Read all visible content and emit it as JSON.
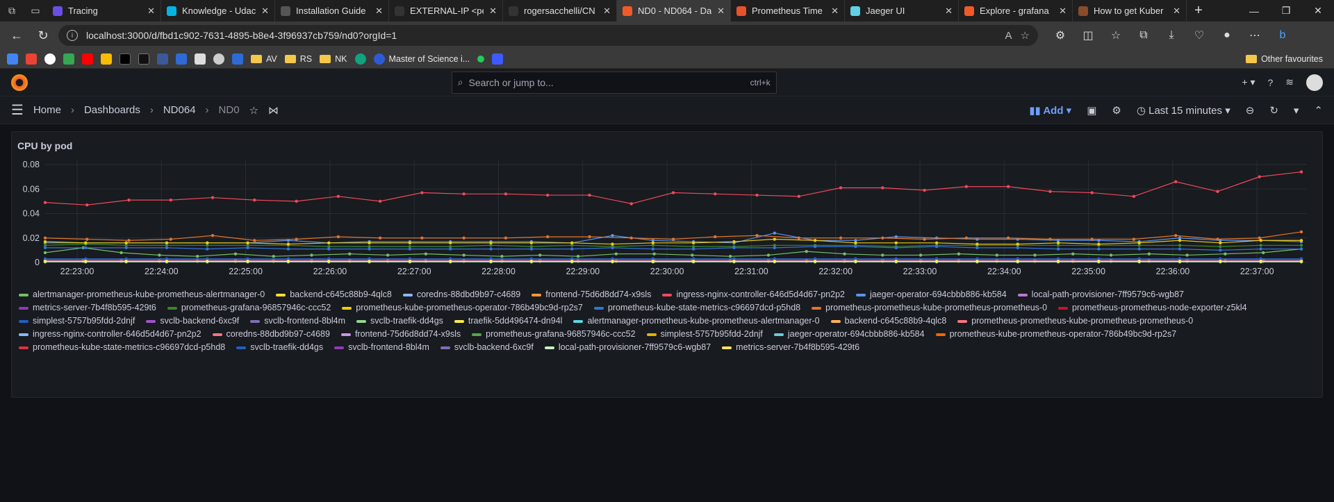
{
  "browser": {
    "tabs": [
      {
        "label": "Tracing",
        "color": "#6b4ee6"
      },
      {
        "label": "Knowledge - Udac",
        "color": "#02b3e4"
      },
      {
        "label": "Installation Guide",
        "color": "#555"
      },
      {
        "label": "EXTERNAL-IP <pe",
        "color": "#333"
      },
      {
        "label": "rogersacchelli/CN",
        "color": "#333"
      },
      {
        "label": "ND0 - ND064 - Da",
        "color": "#f05a28"
      },
      {
        "label": "Prometheus Time",
        "color": "#e6522c"
      },
      {
        "label": "Jaeger UI",
        "color": "#60d0e4"
      },
      {
        "label": "Explore - grafana",
        "color": "#f05a28"
      },
      {
        "label": "How to get Kuber",
        "color": "#8a4b2a"
      }
    ],
    "url": "localhost:3000/d/fbd1c902-7631-4895-b8e4-3f96937cb759/nd0?orgId=1",
    "bookmarks": [
      {
        "type": "folder",
        "label": "AV"
      },
      {
        "type": "folder",
        "label": "RS"
      },
      {
        "type": "folder",
        "label": "NK"
      },
      {
        "type": "link",
        "label": "Master of Science i..."
      }
    ],
    "other_favourites": "Other favourites"
  },
  "grafana": {
    "search_placeholder": "Search or jump to...",
    "search_shortcut": "ctrl+k",
    "breadcrumbs": [
      "Home",
      "Dashboards",
      "ND064",
      "ND0"
    ],
    "add_label": "Add",
    "time_range": "Last 15 minutes"
  },
  "panel": {
    "title": "CPU by pod"
  },
  "chart_data": {
    "type": "line",
    "x_ticks": [
      "22:23:00",
      "22:24:00",
      "22:25:00",
      "22:26:00",
      "22:27:00",
      "22:28:00",
      "22:29:00",
      "22:30:00",
      "22:31:00",
      "22:32:00",
      "22:33:00",
      "22:34:00",
      "22:35:00",
      "22:36:00",
      "22:37:00"
    ],
    "y_ticks": [
      "0",
      "0.02",
      "0.04",
      "0.06",
      "0.08"
    ],
    "ylim": [
      0,
      0.08
    ],
    "grid": true,
    "legend": "bottom",
    "series": [
      {
        "name": "alertmanager-prometheus-kube-prometheus-alertmanager-0",
        "color": "#73bf69",
        "values": [
          0.008,
          0.012,
          0.008,
          0.006,
          0.005,
          0.007,
          0.005,
          0.006,
          0.007,
          0.006,
          0.007,
          0.006,
          0.005,
          0.006,
          0.005,
          0.007,
          0.007,
          0.006,
          0.005,
          0.006,
          0.009,
          0.007,
          0.006,
          0.006,
          0.007,
          0.006,
          0.006,
          0.007,
          0.006,
          0.007,
          0.006,
          0.007,
          0.008,
          0.011
        ]
      },
      {
        "name": "backend-c645c88b9-4qlc8",
        "color": "#fade2a",
        "values": [
          0.001,
          0.001,
          0.001,
          0.001,
          0.001,
          0.001,
          0.001,
          0.001,
          0.001,
          0.001,
          0.001,
          0.001,
          0.001,
          0.001,
          0.001,
          0.001,
          0.001,
          0.001,
          0.001,
          0.001,
          0.001,
          0.001,
          0.001,
          0.001,
          0.001,
          0.001,
          0.001,
          0.001,
          0.001,
          0.001,
          0.001,
          0.001,
          0.001,
          0.001
        ]
      },
      {
        "name": "coredns-88dbd9b97-c4689",
        "color": "#8ab8ff",
        "values": [
          0.002,
          0.002,
          0.002,
          0.002,
          0.002,
          0.002,
          0.002,
          0.002,
          0.002,
          0.002,
          0.002,
          0.002,
          0.002,
          0.002,
          0.002,
          0.002,
          0.002,
          0.002,
          0.002,
          0.002,
          0.002,
          0.002,
          0.002,
          0.002,
          0.002,
          0.002,
          0.002,
          0.002,
          0.002,
          0.002,
          0.002,
          0.002,
          0.002,
          0.002
        ]
      },
      {
        "name": "frontend-75d6d8dd74-x9sls",
        "color": "#ff9830",
        "values": [
          0.001,
          0.001,
          0.001,
          0.001,
          0.001,
          0.001,
          0.001,
          0.001,
          0.001,
          0.001,
          0.001,
          0.001,
          0.001,
          0.001,
          0.001,
          0.001,
          0.001,
          0.001,
          0.001,
          0.001,
          0.001,
          0.001,
          0.001,
          0.001,
          0.001,
          0.001,
          0.001,
          0.001,
          0.001,
          0.001,
          0.001,
          0.001,
          0.001,
          0.001
        ]
      },
      {
        "name": "ingress-nginx-controller-646d5d4d67-pn2p2",
        "color": "#f2495c",
        "values": [
          0.049,
          0.047,
          0.051,
          0.051,
          0.053,
          0.051,
          0.05,
          0.054,
          0.05,
          0.057,
          0.056,
          0.056,
          0.055,
          0.055,
          0.048,
          0.057,
          0.056,
          0.055,
          0.054,
          0.061,
          0.061,
          0.059,
          0.062,
          0.062,
          0.058,
          0.057,
          0.054,
          0.066,
          0.058,
          0.07,
          0.074
        ]
      },
      {
        "name": "jaeger-operator-694cbbb886-kb584",
        "color": "#5794f2",
        "values": [
          0.016,
          0.016,
          0.016,
          0.016,
          0.016,
          0.016,
          0.018,
          0.016,
          0.017,
          0.017,
          0.017,
          0.017,
          0.017,
          0.016,
          0.022,
          0.018,
          0.017,
          0.016,
          0.024,
          0.018,
          0.018,
          0.021,
          0.02,
          0.019,
          0.019,
          0.018,
          0.018,
          0.017,
          0.02,
          0.018,
          0.018,
          0.017
        ]
      },
      {
        "name": "local-path-provisioner-7ff9579c6-wgb87",
        "color": "#b877d9",
        "values": [
          0.001,
          0.001,
          0.001,
          0.001,
          0.001,
          0.001,
          0.001,
          0.001,
          0.001,
          0.001,
          0.001,
          0.001,
          0.001,
          0.001,
          0.001,
          0.001,
          0.001,
          0.001,
          0.001,
          0.001,
          0.001,
          0.001,
          0.001,
          0.001,
          0.001,
          0.001,
          0.001,
          0.001,
          0.001,
          0.001,
          0.001,
          0.001
        ]
      },
      {
        "name": "metrics-server-7b4f8b595-429t6",
        "color": "#8f3bb8",
        "values": [
          0.002,
          0.002,
          0.002,
          0.002,
          0.002,
          0.002,
          0.002,
          0.002,
          0.002,
          0.002,
          0.002,
          0.002,
          0.002,
          0.002,
          0.002,
          0.002,
          0.002,
          0.002,
          0.002,
          0.002,
          0.002,
          0.002,
          0.002,
          0.002,
          0.002,
          0.002,
          0.002,
          0.002,
          0.002,
          0.002,
          0.002,
          0.002
        ]
      },
      {
        "name": "prometheus-grafana-96857946c-ccc52",
        "color": "#37872d",
        "values": [
          0.014,
          0.015,
          0.014,
          0.014,
          0.014,
          0.014,
          0.014,
          0.013,
          0.013,
          0.013,
          0.013,
          0.014,
          0.013,
          0.014,
          0.013,
          0.014,
          0.013,
          0.013,
          0.014,
          0.014,
          0.014,
          0.013,
          0.014,
          0.014,
          0.014,
          0.014,
          0.014,
          0.014,
          0.014,
          0.013,
          0.014,
          0.014
        ]
      },
      {
        "name": "prometheus-kube-prometheus-operator-786b49bc9d-rp2s7",
        "color": "#f2cc0c",
        "values": [
          0.017,
          0.016,
          0.016,
          0.016,
          0.016,
          0.016,
          0.015,
          0.016,
          0.016,
          0.016,
          0.016,
          0.016,
          0.016,
          0.016,
          0.015,
          0.016,
          0.016,
          0.017,
          0.019,
          0.018,
          0.016,
          0.016,
          0.016,
          0.015,
          0.015,
          0.016,
          0.015,
          0.016,
          0.018,
          0.016,
          0.018,
          0.018
        ]
      },
      {
        "name": "prometheus-kube-state-metrics-c96697dcd-p5hd8",
        "color": "#3274d9",
        "values": [
          0.012,
          0.012,
          0.012,
          0.012,
          0.011,
          0.012,
          0.011,
          0.011,
          0.011,
          0.011,
          0.011,
          0.011,
          0.011,
          0.011,
          0.012,
          0.011,
          0.011,
          0.012,
          0.012,
          0.013,
          0.013,
          0.012,
          0.013,
          0.012,
          0.012,
          0.011,
          0.011,
          0.011,
          0.011,
          0.01,
          0.011,
          0.011
        ]
      },
      {
        "name": "prometheus-prometheus-kube-prometheus-prometheus-0",
        "color": "#e0752d",
        "values": [
          0.02,
          0.019,
          0.018,
          0.019,
          0.022,
          0.018,
          0.019,
          0.021,
          0.02,
          0.02,
          0.02,
          0.02,
          0.021,
          0.021,
          0.02,
          0.019,
          0.021,
          0.022,
          0.02,
          0.02,
          0.02,
          0.019,
          0.02,
          0.02,
          0.019,
          0.019,
          0.019,
          0.022,
          0.019,
          0.02,
          0.025
        ]
      },
      {
        "name": "prometheus-prometheus-node-exporter-z5kl4",
        "color": "#c4162a",
        "values": [
          0.003,
          0.003,
          0.003,
          0.003,
          0.003,
          0.003,
          0.003,
          0.003,
          0.003,
          0.003,
          0.003,
          0.003,
          0.003,
          0.003,
          0.003,
          0.003,
          0.003,
          0.003,
          0.003,
          0.003,
          0.003,
          0.003,
          0.003,
          0.003,
          0.003,
          0.003,
          0.003,
          0.003,
          0.003,
          0.003,
          0.003,
          0.003
        ]
      },
      {
        "name": "simplest-5757b95fdd-2dnjf",
        "color": "#1f60c4",
        "values": [
          0.003,
          0.003,
          0.003,
          0.003,
          0.003,
          0.003,
          0.003,
          0.003,
          0.003,
          0.003,
          0.003,
          0.003,
          0.003,
          0.003,
          0.003,
          0.003,
          0.003,
          0.003,
          0.003,
          0.003,
          0.003,
          0.003,
          0.003,
          0.003,
          0.003,
          0.003,
          0.003,
          0.003,
          0.003,
          0.003,
          0.003,
          0.003
        ]
      },
      {
        "name": "svclb-backend-6xc9f",
        "color": "#a352cc",
        "values": [
          0.0005,
          0.0005,
          0.0005,
          0.0005,
          0.0005,
          0.0005,
          0.0005,
          0.0005,
          0.0005,
          0.0005,
          0.0005,
          0.0005,
          0.0005,
          0.0005,
          0.0005,
          0.0005,
          0.0005,
          0.0005,
          0.0005,
          0.0005,
          0.0005,
          0.0005,
          0.0005,
          0.0005,
          0.0005,
          0.0005,
          0.0005,
          0.0005,
          0.0005,
          0.0005,
          0.0005,
          0.0005
        ]
      },
      {
        "name": "svclb-frontend-8bl4m",
        "color": "#806eb7",
        "values": [
          0.0005,
          0.0005,
          0.0005,
          0.0005,
          0.0005,
          0.0005,
          0.0005,
          0.0005,
          0.0005,
          0.0005,
          0.0005,
          0.0005,
          0.0005,
          0.0005,
          0.0005,
          0.0005,
          0.0005,
          0.0005,
          0.0005,
          0.0005,
          0.0005,
          0.0005,
          0.0005,
          0.0005,
          0.0005,
          0.0005,
          0.0005,
          0.0005,
          0.0005,
          0.0005,
          0.0005,
          0.0005
        ]
      },
      {
        "name": "svclb-traefik-dd4gs",
        "color": "#96d98d",
        "values": [
          0.0005,
          0.0005,
          0.0005,
          0.0005,
          0.0005,
          0.0005,
          0.0005,
          0.0005,
          0.0005,
          0.0005,
          0.0005,
          0.0005,
          0.0005,
          0.0005,
          0.0005,
          0.0005,
          0.0005,
          0.0005,
          0.0005,
          0.0005,
          0.0005,
          0.0005,
          0.0005,
          0.0005,
          0.0005,
          0.0005,
          0.0005,
          0.0005,
          0.0005,
          0.0005,
          0.0005,
          0.0005
        ]
      },
      {
        "name": "traefik-5dd496474-dn94l",
        "color": "#ffee52",
        "values": [
          0.001,
          0.001,
          0.001,
          0.001,
          0.001,
          0.001,
          0.001,
          0.001,
          0.001,
          0.001,
          0.001,
          0.001,
          0.001,
          0.001,
          0.001,
          0.001,
          0.001,
          0.001,
          0.001,
          0.001,
          0.001,
          0.001,
          0.001,
          0.001,
          0.001,
          0.001,
          0.001,
          0.001,
          0.001,
          0.001,
          0.001,
          0.001
        ]
      }
    ],
    "legend_entries": [
      {
        "name": "alertmanager-prometheus-kube-prometheus-alertmanager-0",
        "color": "#73bf69"
      },
      {
        "name": "backend-c645c88b9-4qlc8",
        "color": "#fade2a"
      },
      {
        "name": "coredns-88dbd9b97-c4689",
        "color": "#8ab8ff"
      },
      {
        "name": "frontend-75d6d8dd74-x9sls",
        "color": "#ff9830"
      },
      {
        "name": "ingress-nginx-controller-646d5d4d67-pn2p2",
        "color": "#f2495c"
      },
      {
        "name": "jaeger-operator-694cbbb886-kb584",
        "color": "#5794f2"
      },
      {
        "name": "local-path-provisioner-7ff9579c6-wgb87",
        "color": "#b877d9"
      },
      {
        "name": "metrics-server-7b4f8b595-429t6",
        "color": "#8f3bb8"
      },
      {
        "name": "prometheus-grafana-96857946c-ccc52",
        "color": "#37872d"
      },
      {
        "name": "prometheus-kube-prometheus-operator-786b49bc9d-rp2s7",
        "color": "#f2cc0c"
      },
      {
        "name": "prometheus-kube-state-metrics-c96697dcd-p5hd8",
        "color": "#3274d9"
      },
      {
        "name": "prometheus-prometheus-kube-prometheus-prometheus-0",
        "color": "#e0752d"
      },
      {
        "name": "prometheus-prometheus-node-exporter-z5kl4",
        "color": "#c4162a"
      },
      {
        "name": "simplest-5757b95fdd-2dnjf",
        "color": "#1f60c4"
      },
      {
        "name": "svclb-backend-6xc9f",
        "color": "#a352cc"
      },
      {
        "name": "svclb-frontend-8bl4m",
        "color": "#806eb7"
      },
      {
        "name": "svclb-traefik-dd4gs",
        "color": "#96d98d"
      },
      {
        "name": "traefik-5dd496474-dn94l",
        "color": "#ffee52"
      },
      {
        "name": "alertmanager-prometheus-kube-prometheus-alertmanager-0",
        "color": "#5ad8e6"
      },
      {
        "name": "backend-c645c88b9-4qlc8",
        "color": "#ffb357"
      },
      {
        "name": "prometheus-prometheus-kube-prometheus-prometheus-0",
        "color": "#ff7383"
      },
      {
        "name": "ingress-nginx-controller-646d5d4d67-pn2p2",
        "color": "#8ab8ff"
      },
      {
        "name": "coredns-88dbd9b97-c4689",
        "color": "#ff7383"
      },
      {
        "name": "frontend-75d6d8dd74-x9sls",
        "color": "#ca95e5"
      },
      {
        "name": "prometheus-grafana-96857946c-ccc52",
        "color": "#56a64b"
      },
      {
        "name": "simplest-5757b95fdd-2dnjf",
        "color": "#e0b400"
      },
      {
        "name": "jaeger-operator-694cbbb886-kb584",
        "color": "#6ccadc"
      },
      {
        "name": "prometheus-kube-prometheus-operator-786b49bc9d-rp2s7",
        "color": "#fa6400"
      },
      {
        "name": "prometheus-kube-state-metrics-c96697dcd-p5hd8",
        "color": "#e02f44"
      },
      {
        "name": "svclb-traefik-dd4gs",
        "color": "#1f60c4"
      },
      {
        "name": "svclb-frontend-8bl4m",
        "color": "#8f3bb8"
      },
      {
        "name": "svclb-backend-6xc9f",
        "color": "#806eb7"
      },
      {
        "name": "local-path-provisioner-7ff9579c6-wgb87",
        "color": "#c8f2c2"
      },
      {
        "name": "metrics-server-7b4f8b595-429t6",
        "color": "#ffe45a"
      }
    ]
  }
}
